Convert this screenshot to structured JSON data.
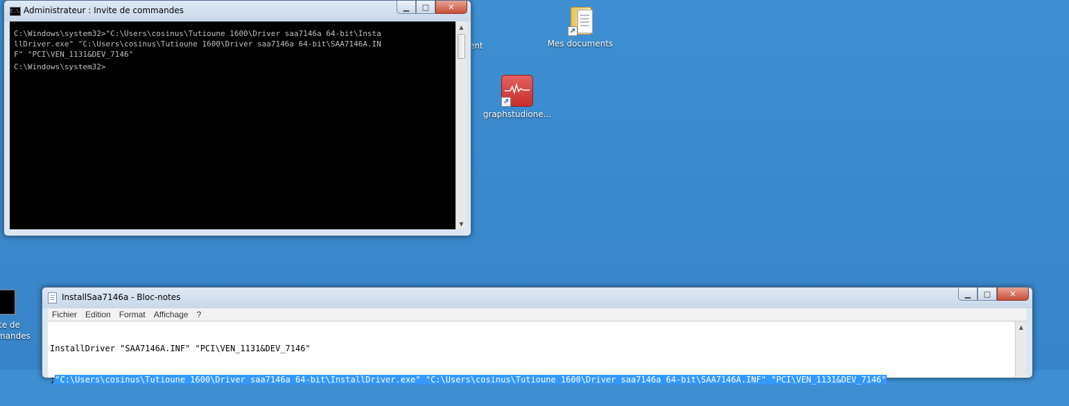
{
  "desktop": {
    "icons": [
      {
        "label": "Mes documents"
      },
      {
        "label": "graphstudione..."
      }
    ],
    "partial_labels": [
      "ent",
      "te de",
      "mandes"
    ]
  },
  "cmd_window": {
    "title": "Administrateur : Invite de commandes",
    "lines": [
      "C:\\Windows\\system32>\"C:\\Users\\cosinus\\Tutioune 1600\\Driver saa7146a 64-bit\\Insta",
      "llDriver.exe\" \"C:\\Users\\cosinus\\Tutioune 1600\\Driver saa7146a 64-bit\\SAA7146A.IN",
      "F\" \"PCI\\VEN_1131&DEV_7146\"",
      "",
      "C:\\Windows\\system32>"
    ]
  },
  "notepad_window": {
    "title": "InstallSaa7146a - Bloc-notes",
    "menu": [
      "Fichier",
      "Edition",
      "Format",
      "Affichage",
      "?"
    ],
    "line1": "InstallDriver \"SAA7146A.INF\" \"PCI\\VEN_1131&DEV_7146\"",
    "line2_prefix": ";",
    "line2_selected": "\"C:\\Users\\cosinus\\Tutioune 1600\\Driver saa7146a 64-bit\\InstallDriver.exe\" \"C:\\Users\\cosinus\\Tutioune 1600\\Driver saa7146a 64-bit\\SAA7146A.INF\" \"PCI\\VEN_1131&DEV_7146\""
  },
  "icons": {
    "minimize": "minimize-icon",
    "maximize": "maximize-icon",
    "close": "close-icon"
  }
}
